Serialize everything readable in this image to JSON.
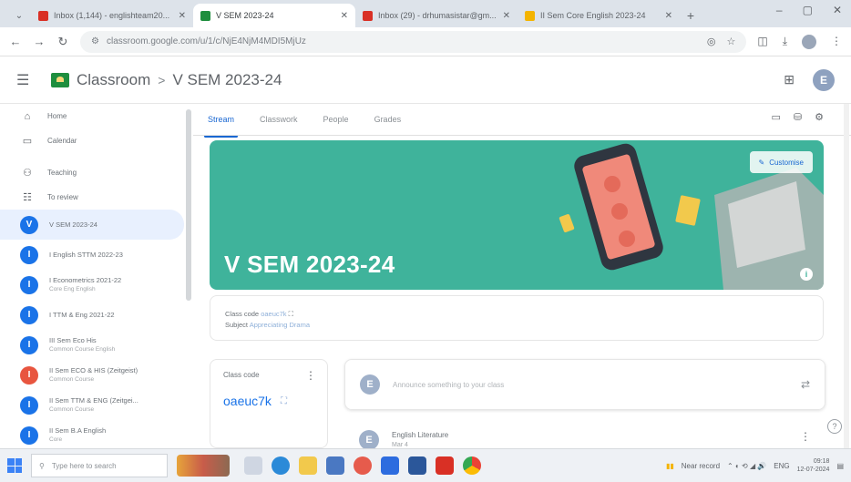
{
  "browser": {
    "tabs": [
      {
        "title": "Inbox (1,144) - englishteam20...",
        "color": "#d93025",
        "active": false
      },
      {
        "title": "V SEM 2023-24",
        "color": "#1e8e3e",
        "active": true
      },
      {
        "title": "Inbox (29) - drhumasistar@gm...",
        "color": "#d93025",
        "active": false
      },
      {
        "title": "II Sem Core English 2023-24",
        "color": "#f4b400",
        "active": false
      }
    ],
    "url": "classroom.google.com/u/1/c/NjE4NjM4MDI5MjUz",
    "newtab": "+",
    "controls": [
      "–",
      "▢",
      "✕"
    ]
  },
  "header": {
    "app_name": "Classroom",
    "separator": ">",
    "class_title": "V SEM 2023-24",
    "avatar_letter": "E"
  },
  "sidebar": {
    "nav": [
      {
        "icon": "home-icon",
        "glyph": "⌂",
        "label": "Home"
      },
      {
        "icon": "calendar-icon",
        "glyph": "▭",
        "label": "Calendar"
      },
      {
        "icon": "teaching-icon",
        "glyph": "👥",
        "label": "Teaching"
      },
      {
        "icon": "to-review-icon",
        "glyph": "☰",
        "label": "To review"
      }
    ],
    "classes": [
      {
        "letter": "V",
        "name": "V SEM 2023-24",
        "sub": "",
        "color": "#1a73e8",
        "selected": true
      },
      {
        "letter": "I",
        "name": "I English STTM 2022-23",
        "sub": "",
        "color": "#1a73e8"
      },
      {
        "letter": "I",
        "name": "I Econometrics 2021-22",
        "sub": "Core Eng English",
        "color": "#1a73e8"
      },
      {
        "letter": "I",
        "name": "I TTM & Eng 2021-22",
        "sub": "",
        "color": "#1a73e8"
      },
      {
        "letter": "I",
        "name": "III Sem Eco His",
        "sub": "Common Course English",
        "color": "#1a73e8"
      },
      {
        "letter": "I",
        "name": "II Sem ECO & HIS (Zeitgeist)",
        "sub": "Common Course",
        "color": "#e8553f"
      },
      {
        "letter": "I",
        "name": "II Sem TTM & ENG (Zeitgei...",
        "sub": "Common Course",
        "color": "#1a73e8"
      },
      {
        "letter": "I",
        "name": "II Sem B.A English",
        "sub": "Core",
        "color": "#1a73e8"
      }
    ]
  },
  "main": {
    "tabs": [
      "Stream",
      "Classwork",
      "People",
      "Grades"
    ],
    "active_tab": "Stream",
    "banner": {
      "title": "V SEM 2023-24",
      "customise_label": "Customise",
      "color": "#3fb39b"
    },
    "class_info": {
      "class_code_label": "Class code",
      "class_code_value": "oaeuc7k",
      "subject_label": "Subject",
      "subject_value": "Appreciating Drama"
    },
    "code_card": {
      "label": "Class code",
      "code": "oaeuc7k"
    },
    "announce": {
      "avatar": "E",
      "placeholder": "Announce something to your class"
    },
    "post": {
      "avatar": "E",
      "title": "English Literature",
      "sub": "Mar 4"
    }
  },
  "taskbar": {
    "search_placeholder": "Type here to search",
    "tray_text": "Near record",
    "lang": "ENG",
    "time": "09:18",
    "date": "12-07-2024"
  }
}
